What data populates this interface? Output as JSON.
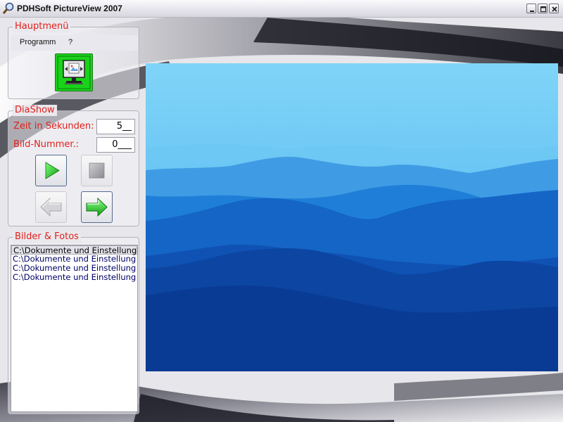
{
  "window": {
    "title": "PDHSoft PictureView 2007"
  },
  "main_group": {
    "legend": "Hauptmenü",
    "menu": [
      "Programm",
      "?"
    ]
  },
  "slideshow_group": {
    "legend": "DiaShow",
    "seconds_label": "Zeit in Sekunden:",
    "seconds_value": "5__",
    "image_number_label": "Bild-Nummer.:",
    "image_number_value": "0___"
  },
  "pictures_group": {
    "legend": "Bilder & Fotos",
    "files": [
      "C:\\Dokumente und Einstellung",
      "C:\\Dokumente und Einstellung",
      "C:\\Dokumente und Einstellung",
      "C:\\Dokumente und Einstellung"
    ],
    "selected_index": 0
  },
  "icons": {
    "app": "magnifier-icon",
    "minimize": "minimize-icon",
    "maximize": "maximize-icon",
    "close": "close-icon",
    "main": "monitor-picture-icon",
    "play": "play-icon",
    "stop": "stop-icon",
    "previous": "arrow-left-icon",
    "next": "arrow-right-icon"
  },
  "colors": {
    "legend_text": "#e0201a",
    "list_text": "#000066",
    "icon_green": "#19d319"
  }
}
